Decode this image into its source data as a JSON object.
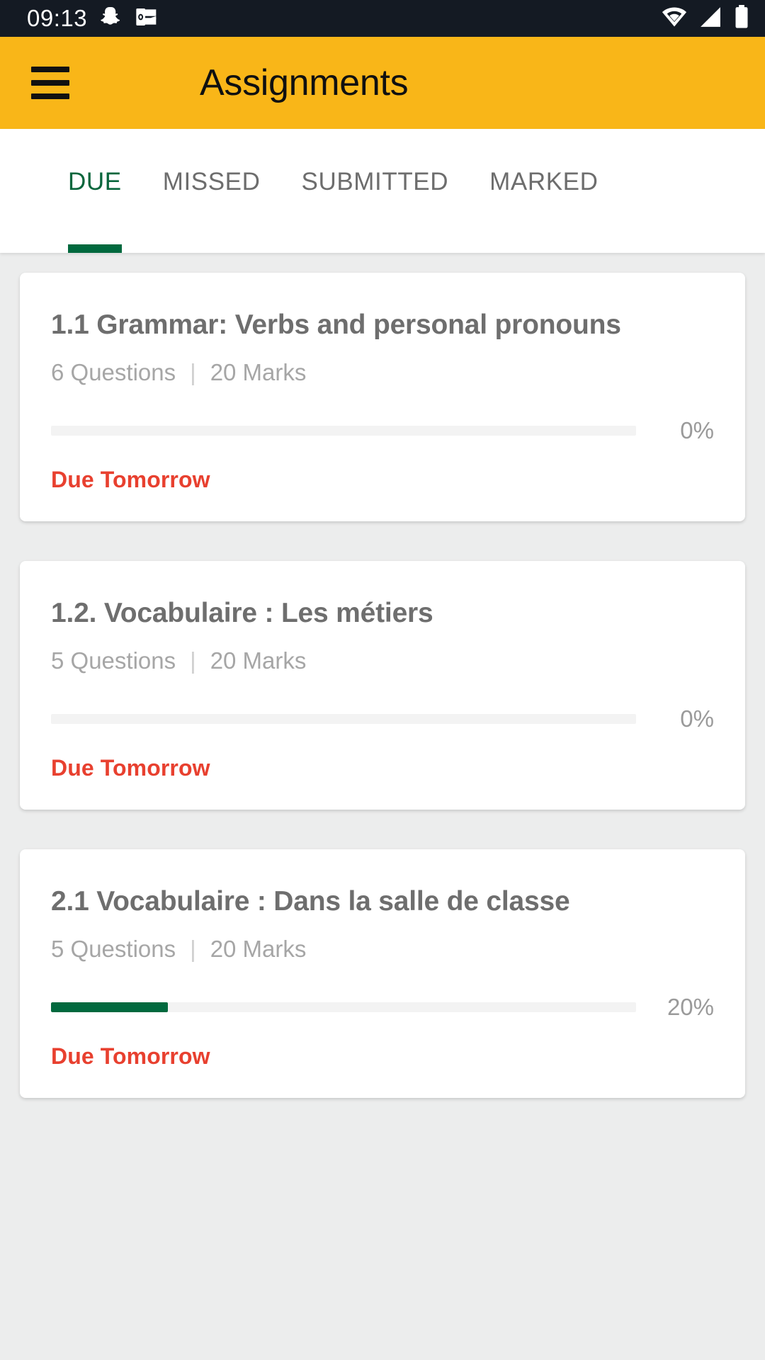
{
  "status_bar": {
    "time": "09:13",
    "left_icons": [
      "snapchat-icon",
      "outlook-icon"
    ],
    "right_icons": [
      "wifi-icon",
      "cellular-signal-icon",
      "battery-icon"
    ],
    "background_color": "#141a23"
  },
  "app_bar": {
    "title": "Assignments",
    "menu_icon": "hamburger-menu-icon",
    "background_color": "#f9b618",
    "text_color": "#101010"
  },
  "tabs": {
    "active_index": 0,
    "active_color": "#00693e",
    "inactive_color": "#6d6d6d",
    "items": [
      {
        "label": "DUE"
      },
      {
        "label": "MISSED"
      },
      {
        "label": "SUBMITTED"
      },
      {
        "label": "MARKED"
      }
    ]
  },
  "assignments": [
    {
      "title": "1.1 Grammar: Verbs and personal pronouns",
      "questions": "6 Questions",
      "separator": "|",
      "marks": "20 Marks",
      "progress_percent": 0,
      "progress_label": "0%",
      "due": "Due Tomorrow"
    },
    {
      "title": "1.2. Vocabulaire : Les métiers",
      "questions": "5 Questions",
      "separator": "|",
      "marks": "20 Marks",
      "progress_percent": 0,
      "progress_label": "0%",
      "due": "Due Tomorrow"
    },
    {
      "title": "2.1 Vocabulaire : Dans la salle de classe",
      "questions": "5 Questions",
      "separator": "|",
      "marks": "20 Marks",
      "progress_percent": 20,
      "progress_label": "20%",
      "due": "Due Tomorrow"
    }
  ],
  "colors": {
    "accent_green": "#00693e",
    "brand_amber": "#f9b618",
    "due_red": "#e8402f",
    "page_background": "#eceded"
  }
}
